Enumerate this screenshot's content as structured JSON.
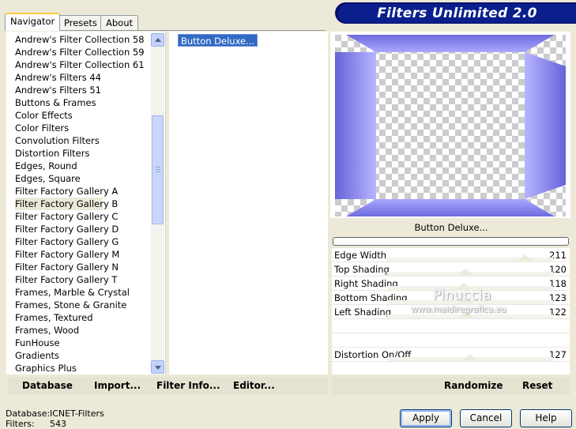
{
  "tabs": [
    {
      "label": "Navigator",
      "active": true
    },
    {
      "label": "Presets",
      "active": false
    },
    {
      "label": "About",
      "active": false
    }
  ],
  "app": {
    "title": "Filters Unlimited 2.0"
  },
  "categories": [
    "Andrew's Filter Collection 58",
    "Andrew's Filter Collection 59",
    "Andrew's Filter Collection 61",
    "Andrew's Filters 44",
    "Andrew's Filters 51",
    "Buttons & Frames",
    "Color Effects",
    "Color Filters",
    "Convolution Filters",
    "Distortion Filters",
    "Edges, Round",
    "Edges, Square",
    "Filter Factory Gallery A",
    "Filter Factory Gallery B",
    "Filter Factory Gallery C",
    "Filter Factory Gallery D",
    "Filter Factory Gallery G",
    "Filter Factory Gallery M",
    "Filter Factory Gallery N",
    "Filter Factory Gallery T",
    "Frames, Marble & Crystal",
    "Frames, Stone & Granite",
    "Frames, Textured",
    "Frames, Wood",
    "FunHouse",
    "Gradients",
    "Graphics Plus"
  ],
  "selected_category": "Filter Factory Gallery B",
  "filters": [
    "Button Deluxe..."
  ],
  "selected_filter": "Button Deluxe...",
  "preview": {
    "filter_name": "Button Deluxe...",
    "colors": {
      "frame": "#7a78e6",
      "frame_light": "#b5b3ff",
      "checker_a": "#ffffff",
      "checker_b": "#cccccc"
    }
  },
  "params": [
    {
      "label": "Edge Width",
      "value": "211"
    },
    {
      "label": "Top Shading",
      "value": "120"
    },
    {
      "label": "Right Shading",
      "value": "118"
    },
    {
      "label": "Bottom Shading",
      "value": "123"
    },
    {
      "label": "Left Shading",
      "value": "122"
    },
    {
      "label": "",
      "value": ""
    },
    {
      "label": "",
      "value": ""
    },
    {
      "label": "Distortion On/Off",
      "value": "127"
    }
  ],
  "watermark": {
    "name": "Pinuccia",
    "url": "www.maidiregrafica.eu"
  },
  "toolbar_left": {
    "database": "Database",
    "import": "Import...",
    "filter_info": "Filter Info...",
    "editor": "Editor..."
  },
  "toolbar_right": {
    "randomize": "Randomize",
    "reset": "Reset"
  },
  "status": {
    "database_label": "Database:",
    "database_value": "ICNET-Filters",
    "filters_label": "Filters:",
    "filters_value": "543"
  },
  "buttons": {
    "apply": "Apply",
    "cancel": "Cancel",
    "help": "Help"
  }
}
